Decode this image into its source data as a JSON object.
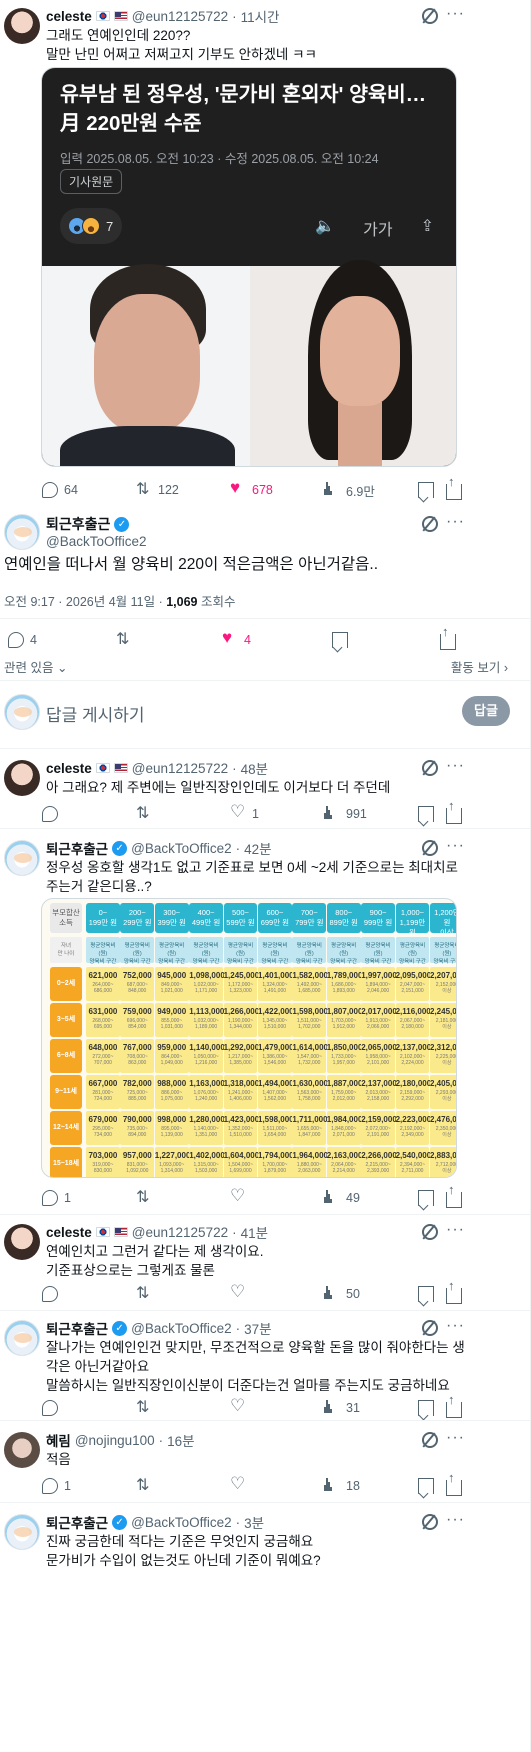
{
  "colors": {
    "like": "#f91880",
    "verified": "#1d9bf0",
    "muted": "#536471",
    "table_header": "#2cb5cf",
    "table_age": "#f5a623",
    "table_cell": "#fbea8b"
  },
  "post1": {
    "name": "celeste",
    "handle": "@eun12125722",
    "time": "11시간",
    "text": "그래도 연예인인데 220??\n말만 난민 어쩌고 저쩌고지 기부도 안하겠네 ㅋㅋ",
    "card": {
      "title": "유부남 된 정우성, '문가비 혼외자' 양육비…\n月 220만원 수준",
      "date": "입력 2025.08.05. 오전 10:23 · 수정 2025.08.05. 오전 10:24",
      "source": "기사원문",
      "reactions": "7",
      "font_label": "가가"
    },
    "replies": "64",
    "retweets": "122",
    "likes": "678",
    "views": "6.9만"
  },
  "focus": {
    "name": "퇴근후출근",
    "handle": "@BackToOffice2",
    "text": "연예인을 떠나서 월 양육비 220이 적은금액은 아닌거같음..",
    "meta_prefix": "오전 9:17 · 2026년 4월 11일 · ",
    "views_count": "1,069",
    "views_label": " 조회수",
    "replies": "4",
    "likes": "4",
    "related": "관련 있음",
    "activity": "활동 보기"
  },
  "reply_box": {
    "placeholder": "답글 게시하기",
    "button": "답글"
  },
  "post2": {
    "name": "celeste",
    "handle": "@eun12125722",
    "time": "48분",
    "text": "아 그래요? 제 주변에는 일반직장인인데도 이거보다 더 주던데",
    "likes": "1",
    "views": "991"
  },
  "post3": {
    "name": "퇴근후출근",
    "handle": "@BackToOffice2",
    "time": "42분",
    "text": "정우성 옹호할 생각1도 없고 기준표로 보면 0세 ~2세 기준으로는 최대치로 주는거 같은디용..?",
    "replies": "1",
    "views": "49",
    "table": {
      "corner_head": "부모합산\n소득",
      "corner_sub": "자녀\n만 나이",
      "headers": [
        "0~\n199만 원",
        "200~\n299만 원",
        "300~\n399만 원",
        "400~\n499만 원",
        "500~\n599만 원",
        "600~\n699만 원",
        "700~\n799만 원",
        "800~\n899만 원",
        "900~\n999만 원",
        "1,000~\n1,199만 원",
        "1,200만 원\n이상"
      ],
      "sub_header": "평균양육비(원)\n양육비 구간",
      "ages": [
        "0~2세",
        "3~5세",
        "6~8세",
        "9~11세",
        "12~14세",
        "15~18세"
      ],
      "values": [
        [
          "621,000",
          "752,000",
          "945,000",
          "1,098,000",
          "1,245,000",
          "1,401,000",
          "1,582,000",
          "1,789,000",
          "1,997,000",
          "2,095,000",
          "2,207,000"
        ],
        [
          "631,000",
          "759,000",
          "949,000",
          "1,113,000",
          "1,266,000",
          "1,422,000",
          "1,598,000",
          "1,807,000",
          "2,017,000",
          "2,116,000",
          "2,245,000"
        ],
        [
          "648,000",
          "767,000",
          "959,000",
          "1,140,000",
          "1,292,000",
          "1,479,000",
          "1,614,000",
          "1,850,000",
          "2,065,000",
          "2,137,000",
          "2,312,000"
        ],
        [
          "667,000",
          "782,000",
          "988,000",
          "1,163,000",
          "1,318,000",
          "1,494,000",
          "1,630,000",
          "1,887,000",
          "2,137,000",
          "2,180,000",
          "2,405,000"
        ],
        [
          "679,000",
          "790,000",
          "998,000",
          "1,280,000",
          "1,423,000",
          "1,598,000",
          "1,711,000",
          "1,984,000",
          "2,159,000",
          "2,223,000",
          "2,476,000"
        ],
        [
          "703,000",
          "957,000",
          "1,227,000",
          "1,402,000",
          "1,604,000",
          "1,794,000",
          "1,964,000",
          "2,163,000",
          "2,266,000",
          "2,540,000",
          "2,883,000"
        ]
      ],
      "ranges": [
        [
          "264,000~\n686,000",
          "687,000~\n848,000",
          "849,000~\n1,021,000",
          "1,022,000~\n1,171,000",
          "1,172,000~\n1,323,000",
          "1,324,000~\n1,491,000",
          "1,492,000~\n1,685,000",
          "1,686,000~\n1,893,000",
          "1,894,000~\n2,046,000",
          "2,047,000~\n2,151,000",
          "2,152,000\n이상"
        ],
        [
          "268,000~\n695,000",
          "696,000~\n854,000",
          "855,000~\n1,031,000",
          "1,032,000~\n1,189,000",
          "1,190,000~\n1,344,000",
          "1,345,000~\n1,510,000",
          "1,511,000~\n1,702,000",
          "1,703,000~\n1,912,000",
          "1,913,000~\n2,066,000",
          "2,067,000~\n2,180,000",
          "2,181,000\n이상"
        ],
        [
          "272,000~\n707,000",
          "708,000~\n863,000",
          "864,000~\n1,049,000",
          "1,050,000~\n1,216,000",
          "1,217,000~\n1,385,000",
          "1,386,000~\n1,546,000",
          "1,547,000~\n1,732,000",
          "1,733,000~\n1,957,000",
          "1,958,000~\n2,101,000",
          "2,102,000~\n2,224,000",
          "2,225,000\n이상"
        ],
        [
          "281,000~\n724,000",
          "725,000~\n885,000",
          "886,000~\n1,075,000",
          "1,076,000~\n1,240,000",
          "1,241,000~\n1,406,000",
          "1,407,000~\n1,562,000",
          "1,563,000~\n1,758,000",
          "1,759,000~\n2,012,000",
          "2,013,000~\n2,158,000",
          "2,159,000~\n2,292,000",
          "2,293,000\n이상"
        ],
        [
          "295,000~\n734,000",
          "735,000~\n894,000",
          "895,000~\n1,139,000",
          "1,140,000~\n1,351,000",
          "1,352,000~\n1,510,000",
          "1,511,000~\n1,654,000",
          "1,655,000~\n1,847,000",
          "1,848,000~\n2,071,000",
          "2,072,000~\n2,191,000",
          "2,192,000~\n2,349,000",
          "2,350,000\n이상"
        ],
        [
          "319,000~\n830,000",
          "831,000~\n1,092,000",
          "1,093,000~\n1,314,000",
          "1,315,000~\n1,503,000",
          "1,504,000~\n1,699,000",
          "1,700,000~\n1,879,000",
          "1,880,000~\n2,063,000",
          "2,064,000~\n2,214,000",
          "2,215,000~\n2,393,000",
          "2,394,000~\n2,711,000",
          "2,712,000\n이상"
        ]
      ]
    }
  },
  "post4": {
    "name": "celeste",
    "handle": "@eun12125722",
    "time": "41분",
    "text": "연예인치고 그런거 같다는 제 생각이요.\n기준표상으로는 그렇게죠 물론",
    "views": "50"
  },
  "post5": {
    "name": "퇴근후출근",
    "handle": "@BackToOffice2",
    "time": "37분",
    "text": "잘나가는 연예인인건 맞지만, 무조건적으로 양육할 돈을 많이 줘야한다는 생각은 아닌거같아요\n말씀하시는 일반직장인이신분이 더준다는건 얼마를 주는지도 궁금하네요",
    "views": "31"
  },
  "post6": {
    "name": "혜림",
    "handle": "@nojingu100",
    "time": "16분",
    "text": "적음",
    "replies": "1",
    "views": "18"
  },
  "post7": {
    "name": "퇴근후출근",
    "handle": "@BackToOffice2",
    "time": "3분",
    "text": "진짜 궁금한데 적다는 기준은 무엇인지 궁금해요\n문가비가 수입이 없는것도 아닌데 기준이 뭐예요?"
  },
  "icons": [
    "grok-icon",
    "more-icon",
    "reply-icon",
    "retweet-icon",
    "like-icon",
    "views-icon",
    "bookmark-icon",
    "share-icon",
    "verified-badge",
    "flag-kr-icon",
    "flag-us-icon"
  ]
}
